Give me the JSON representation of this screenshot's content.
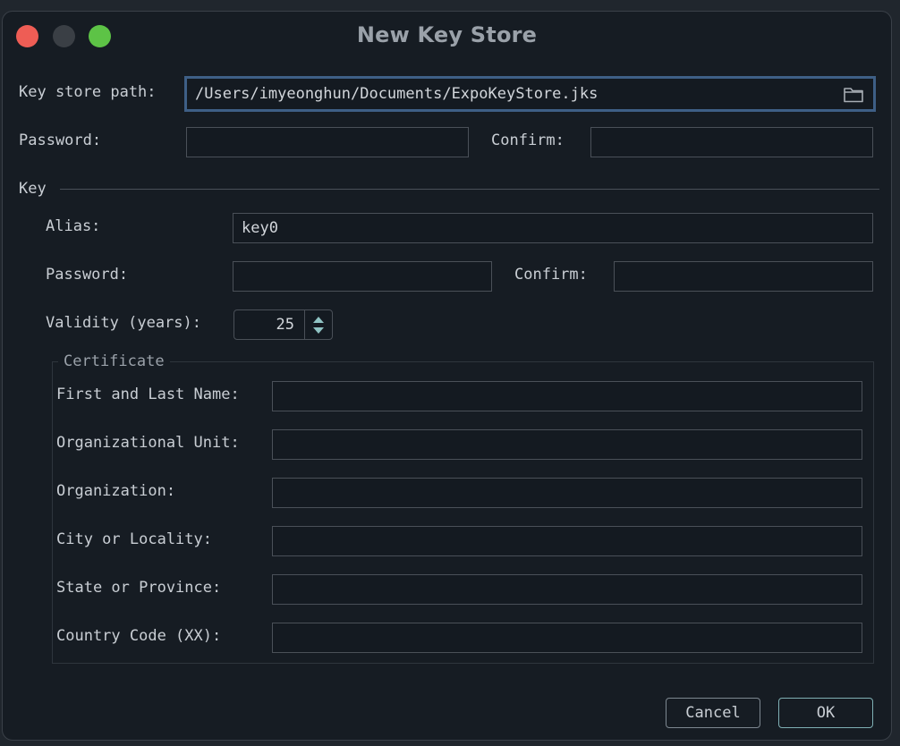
{
  "window": {
    "title": "New Key Store"
  },
  "traffic_lights": {
    "close_color": "#ee5d55",
    "minimize_color": "#3a3f45",
    "maximize_color": "#5dc346"
  },
  "keystore": {
    "path_label": "Key store path:",
    "path_value": "/Users/imyeonghun/Documents/ExpoKeyStore.jks",
    "folder_icon": "folder-icon",
    "password_label": "Password:",
    "password_value": "",
    "confirm_label": "Confirm:",
    "confirm_value": ""
  },
  "key": {
    "section_label": "Key",
    "alias_label": "Alias:",
    "alias_value": "key0",
    "password_label": "Password:",
    "password_value": "",
    "confirm_label": "Confirm:",
    "confirm_value": "",
    "validity_label": "Validity (years):",
    "validity_value": "25"
  },
  "certificate": {
    "legend": "Certificate",
    "fields": [
      {
        "label": "First and Last Name:",
        "value": ""
      },
      {
        "label": "Organizational Unit:",
        "value": ""
      },
      {
        "label": "Organization:",
        "value": ""
      },
      {
        "label": "City or Locality:",
        "value": ""
      },
      {
        "label": "State or Province:",
        "value": ""
      },
      {
        "label": "Country Code (XX):",
        "value": ""
      }
    ]
  },
  "buttons": {
    "cancel_label": "Cancel",
    "ok_label": "OK"
  },
  "colors": {
    "accent_focus": "#3e5f86",
    "spinner_arrow": "#8fc3c3"
  }
}
